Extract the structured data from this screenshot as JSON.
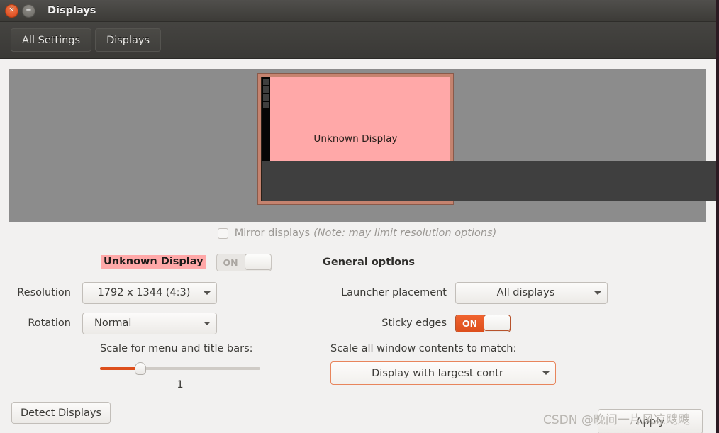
{
  "window": {
    "title": "Displays",
    "close_icon": "close-icon",
    "minimize_icon": "minimize-icon",
    "close_glyph": "✕",
    "minimize_glyph": "−"
  },
  "toolbar": {
    "all_settings_label": "All Settings",
    "displays_label": "Displays"
  },
  "preview": {
    "monitor_label": "Unknown Display",
    "screen_color": "#ffa8a8",
    "bezel_color": "#c5836f",
    "canvas_color": "#8c8c8c",
    "launcher_color": "#050505"
  },
  "mirror": {
    "label": "Mirror displays",
    "note": "(Note: may limit resolution options)",
    "checked": false
  },
  "display_settings": {
    "name": "Unknown Display",
    "name_highlight_color": "#ffa8a8",
    "power_toggle": {
      "state_label": "ON",
      "enabled": false
    },
    "resolution_label": "Resolution",
    "resolution_value": "1792 x 1344 (4:3)",
    "rotation_label": "Rotation",
    "rotation_value": "Normal",
    "scale_title": "Scale for menu and title bars:",
    "scale_value": "1",
    "scale_percent": 25,
    "scale_fill_color": "#dd4f1c"
  },
  "general_options": {
    "title": "General options",
    "launcher_placement_label": "Launcher placement",
    "launcher_placement_value": "All displays",
    "sticky_edges_label": "Sticky edges",
    "sticky_edges_state": "ON",
    "scale_contents_title": "Scale all window contents to match:",
    "scale_contents_value": "Display with largest contr",
    "accent_color": "#dd4f1c"
  },
  "bottom": {
    "detect_label": "Detect Displays",
    "apply_label": "Apply"
  },
  "watermark": {
    "text": "CSDN @晚间一片风凉飕飕"
  }
}
